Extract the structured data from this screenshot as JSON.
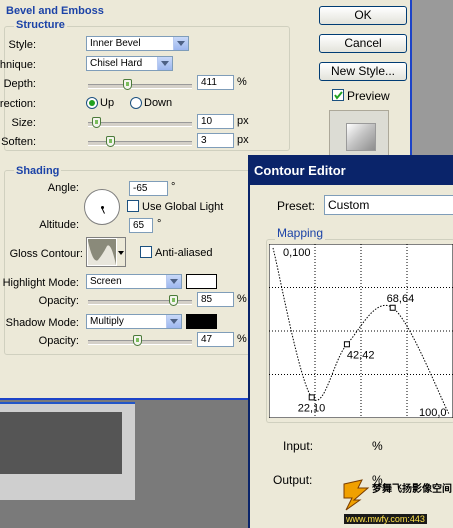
{
  "bevel": {
    "section_title": "Bevel and Emboss",
    "structure_title": "Structure",
    "style_label": "Style:",
    "style_value": "Inner Bevel",
    "technique_label": "Technique:",
    "technique_value": "Chisel Hard",
    "depth_label": "Depth:",
    "depth_value": "411",
    "depth_unit": "%",
    "depth_level": 0.37,
    "direction_label": "Direction:",
    "direction_up": "Up",
    "direction_down": "Down",
    "size_label": "Size:",
    "size_value": "10",
    "size_unit": "px",
    "size_level": 0.04,
    "soften_label": "Soften:",
    "soften_value": "3",
    "soften_unit": "px",
    "soften_level": 0.19
  },
  "shading": {
    "title": "Shading",
    "angle_label": "Angle:",
    "angle_value": "-65",
    "angle_unit": "°",
    "global_light_label": "Use Global Light",
    "altitude_label": "Altitude:",
    "altitude_value": "65",
    "altitude_unit": "°",
    "gloss_contour_label": "Gloss Contour:",
    "anti_aliased_label": "Anti-aliased",
    "highlight_mode_label": "Highlight Mode:",
    "highlight_mode_value": "Screen",
    "highlight_color": "#ffffff",
    "highlight_opacity_label": "Opacity:",
    "highlight_opacity_value": "85",
    "highlight_opacity_unit": "%",
    "highlight_opacity_level": 0.85,
    "shadow_mode_label": "Shadow Mode:",
    "shadow_mode_value": "Multiply",
    "shadow_color": "#000000",
    "shadow_opacity_label": "Opacity:",
    "shadow_opacity_value": "47",
    "shadow_opacity_unit": "%",
    "shadow_opacity_level": 0.47
  },
  "buttons": {
    "ok": "OK",
    "cancel": "Cancel",
    "new_style": "New Style...",
    "preview": "Preview",
    "preview_checked": true
  },
  "contour_editor": {
    "title": "Contour Editor",
    "preset_label": "Preset:",
    "preset_value": "Custom",
    "mapping_label": "Mapping",
    "points": [
      {
        "label": "0,100",
        "input": 0,
        "output": 100
      },
      {
        "label": "22,10",
        "input": 22,
        "output": 10
      },
      {
        "label": "42,42",
        "input": 42,
        "output": 42
      },
      {
        "label": "68,64",
        "input": 68,
        "output": 64
      },
      {
        "label": "100,0",
        "input": 100,
        "output": 0
      }
    ],
    "input_label": "Input:",
    "input_unit": "%",
    "output_label": "Output:",
    "output_unit": "%",
    "title_bar_color": "#0a246a",
    "accent_color": "#1c43a7"
  },
  "watermark": {
    "text": "梦舞飞扬影像空间",
    "url": "www.mwfy.com:443"
  }
}
